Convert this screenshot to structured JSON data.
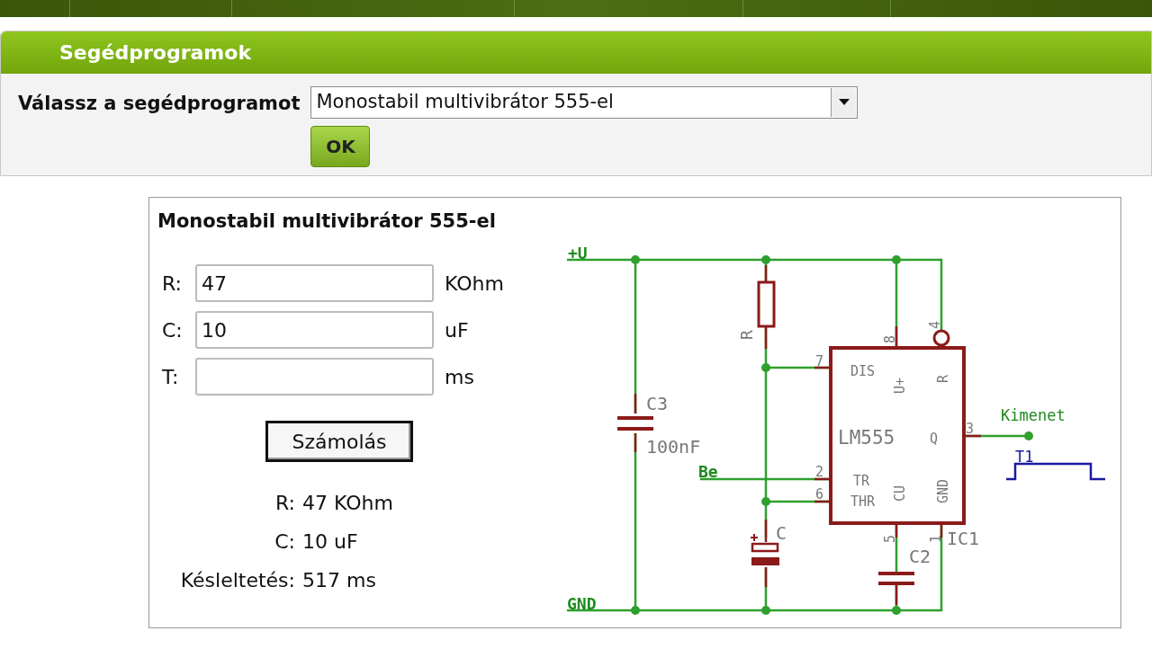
{
  "panel": {
    "title": "Segédprogramok",
    "select_label": "Válassz a segédprogramot",
    "select_value": "Monostabil multivibrátor 555-el",
    "ok_button": "OK"
  },
  "calculator": {
    "title": "Monostabil multivibrátor 555-el",
    "fields": [
      {
        "label": "R:",
        "value": "47",
        "unit": "KOhm"
      },
      {
        "label": "C:",
        "value": "10",
        "unit": "uF"
      },
      {
        "label": "T:",
        "unit": "ms"
      }
    ],
    "button": "Számolás",
    "results": [
      {
        "label": "R:",
        "value": "47 KOhm"
      },
      {
        "label": "C:",
        "value": "10 uF"
      },
      {
        "label": "Késleltetés:",
        "value": "517 ms"
      }
    ],
    "schematic": {
      "labels": [
        "+U",
        "4",
        "R",
        "8",
        "7",
        "DIS",
        "R",
        "U+",
        "C3",
        "Kimenet",
        "3",
        "LM555",
        "Q",
        "100nF",
        "T1",
        "Be",
        "2",
        "TR",
        "GND",
        "CU",
        "6",
        "THR",
        "C",
        "IC1",
        "5",
        "1",
        "C2",
        "GND"
      ]
    }
  }
}
